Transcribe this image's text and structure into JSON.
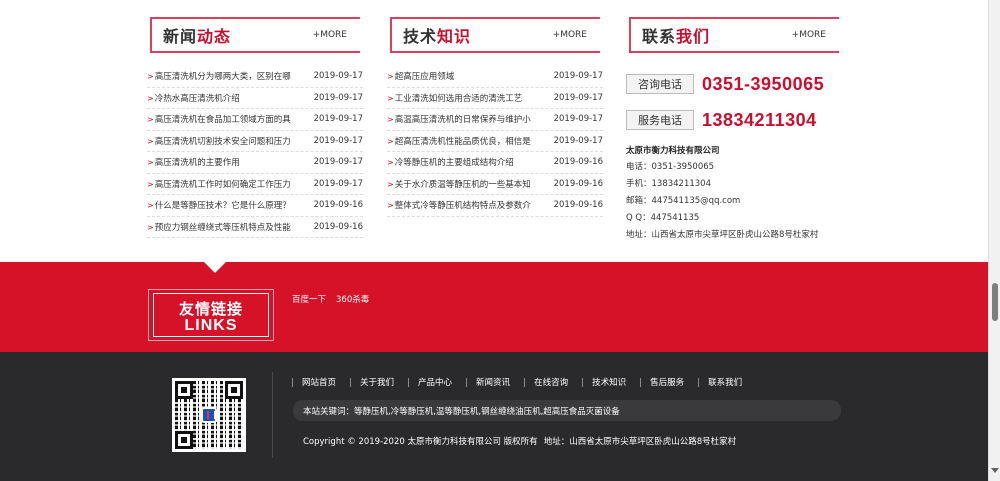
{
  "news": {
    "title_main": "新闻",
    "title_accent": "动态",
    "more": "+MORE",
    "items": [
      {
        "text": "高压清洗机分为哪两大类，区别在哪",
        "date": "2019-09-17"
      },
      {
        "text": "冷热水高压清洗机介绍",
        "date": "2019-09-17"
      },
      {
        "text": "高压清洗机在食品加工领域方面的具",
        "date": "2019-09-17"
      },
      {
        "text": "高压清洗机切割技术安全问题和压力",
        "date": "2019-09-17"
      },
      {
        "text": "高压清洗机的主要作用",
        "date": "2019-09-17"
      },
      {
        "text": "高压清洗机工作时如何确定工作压力",
        "date": "2019-09-17"
      },
      {
        "text": "什么是等静压技术？它是什么原理？",
        "date": "2019-09-16"
      },
      {
        "text": "预应力钢丝缠绕式等压机特点及性能",
        "date": "2019-09-16"
      }
    ]
  },
  "tech": {
    "title_main": "技术",
    "title_accent": "知识",
    "more": "+MORE",
    "items": [
      {
        "text": "超高压应用领域",
        "date": "2019-09-17"
      },
      {
        "text": "工业清洗如何选用合适的清洗工艺",
        "date": "2019-09-17"
      },
      {
        "text": "高温高压清洗机的日常保养与维护小",
        "date": "2019-09-17"
      },
      {
        "text": "超高压清洗机性能品质优良，相信是",
        "date": "2019-09-17"
      },
      {
        "text": "冷等静压机的主要组成结构介绍",
        "date": "2019-09-16"
      },
      {
        "text": "关于水介质温等静压机的一些基本知",
        "date": "2019-09-16"
      },
      {
        "text": "整体式冷等静压机结构特点及参数介",
        "date": "2019-09-16"
      }
    ]
  },
  "contact": {
    "title_main": "联系",
    "title_accent": "我们",
    "more": "+MORE",
    "consult_label": "咨询电话",
    "consult_number": "0351-3950065",
    "service_label": "服务电话",
    "service_number": "13834211304",
    "company": "太原市衡力科技有限公司",
    "phone_line": "电话：0351-3950065",
    "mobile_line": "手机：13834211304",
    "email_line": "邮箱：447541135@qq.com",
    "qq_line": "Q Q：447541135",
    "address_line": "地址：山西省太原市尖草坪区卧虎山公路8号杜家村"
  },
  "links": {
    "title_cn": "友情链接",
    "title_en": "LINKS",
    "items": [
      "百度一下",
      "360杀毒"
    ]
  },
  "footer": {
    "nav": [
      "网站首页",
      "关于我们",
      "产品中心",
      "新闻资讯",
      "在线咨询",
      "技术知识",
      "售后服务",
      "联系我们"
    ],
    "keywords": "本站关键词：等静压机,冷等静压机,温等静压机,钢丝缠绕油压机,超高压食品灭菌设备",
    "copyright": "Copyright © 2019-2020 太原市衡力科技有限公司 版权所有",
    "address": "地址：山西省太原市尖草坪区卧虎山公路8号杜家村"
  },
  "colors": {
    "accent": "#c8102e",
    "band": "#d61229",
    "footer": "#2a2a2c"
  }
}
